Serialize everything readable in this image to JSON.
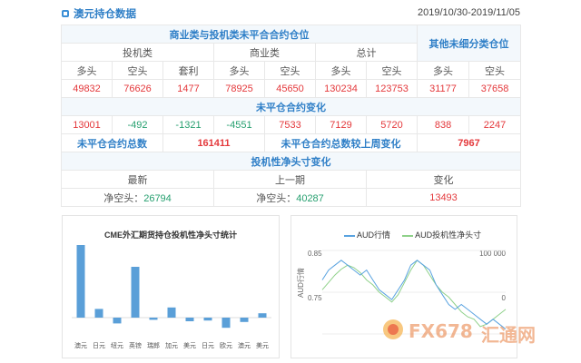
{
  "header": {
    "title": "澳元持仓数据",
    "date_range": "2019/10/30-2019/11/05"
  },
  "table": {
    "group_header": "商业类与投机类未平合合约仓位",
    "other_header": "其他未细分类仓位",
    "sub_headers": [
      "投机类",
      "商业类",
      "总计"
    ],
    "columns": [
      "多头",
      "空头",
      "套利",
      "多头",
      "空头",
      "多头",
      "空头",
      "多头",
      "空头"
    ],
    "values": [
      "49832",
      "76626",
      "1477",
      "78925",
      "45650",
      "130234",
      "123753",
      "31177",
      "37658"
    ],
    "change_header": "未平仓合约变化",
    "change_values": [
      "13001",
      "-492",
      "-1321",
      "-4551",
      "7533",
      "7129",
      "5720",
      "838",
      "2247"
    ],
    "total_label": "未平仓合约总数",
    "total_value": "161411",
    "weekly_label": "未平仓合约总数较上周变化",
    "weekly_value": "7967",
    "net_header": "投机性净头寸变化",
    "net_columns": [
      "最新",
      "上一期",
      "变化"
    ],
    "net_prefix": "净空头：",
    "net_latest": "26794",
    "net_previous": "40287",
    "net_change": "13493"
  },
  "bar_chart": {
    "title": "CME外汇期货持仓投机性净头寸统计",
    "color": "#5a9fd8"
  },
  "line_chart": {
    "legend": [
      "AUD行情",
      "AUD投机性净头寸"
    ],
    "y_left_ticks": [
      "0.85",
      "0.75"
    ],
    "y_left_label": "AUD行情",
    "y_right_ticks": [
      "100 000",
      "0"
    ],
    "colors": [
      "#5aa3e0",
      "#8fd18a"
    ]
  },
  "watermark": {
    "text_latin": "FX678",
    "text_cn": "汇通网"
  },
  "chart_data": [
    {
      "type": "bar",
      "title": "CME外汇期货持仓投机性净头寸统计",
      "categories": [
        "澳元",
        "日元",
        "纽元",
        "英镑",
        "瑞郎",
        "加元",
        "美元",
        "日元",
        "欧元",
        "澳元",
        "美元"
      ],
      "values": [
        100,
        12,
        -8,
        70,
        -3,
        14,
        -5,
        -4,
        -14,
        -6,
        6
      ]
    },
    {
      "type": "line",
      "series": [
        {
          "name": "AUD行情",
          "values": [
            0.8,
            0.82,
            0.83,
            0.84,
            0.83,
            0.82,
            0.81,
            0.82,
            0.8,
            0.78,
            0.77,
            0.76,
            0.78,
            0.8,
            0.83,
            0.84,
            0.83,
            0.82,
            0.79,
            0.77,
            0.75,
            0.74,
            0.75,
            0.74,
            0.73,
            0.72,
            0.71,
            0.72,
            0.71,
            0.7
          ]
        },
        {
          "name": "AUD投机性净头寸",
          "values": [
            20000,
            35000,
            50000,
            62000,
            70000,
            65000,
            55000,
            40000,
            30000,
            15000,
            5000,
            -5000,
            10000,
            35000,
            60000,
            80000,
            70000,
            50000,
            30000,
            15000,
            5000,
            -10000,
            -25000,
            -35000,
            -40000,
            -55000,
            -50000,
            -40000,
            -30000,
            -20000
          ]
        }
      ],
      "y_left": {
        "ticks": [
          "0.85",
          "0.75"
        ]
      },
      "y_right": {
        "ticks": [
          "100 000",
          "0"
        ]
      }
    }
  ]
}
